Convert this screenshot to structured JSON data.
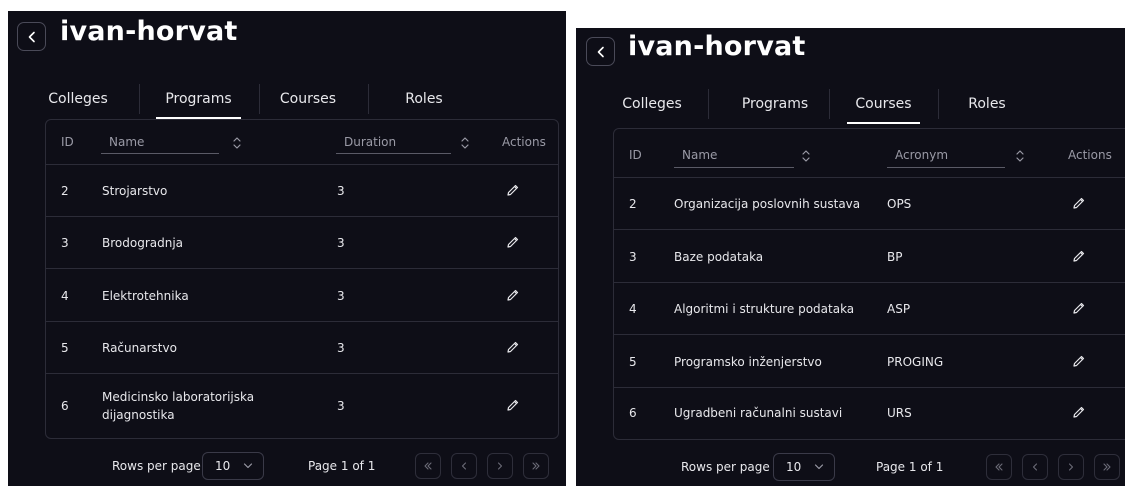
{
  "left": {
    "title": "ivan-horvat",
    "tabs": [
      "Colleges",
      "Programs",
      "Courses",
      "Roles"
    ],
    "active_tab": "Programs",
    "columns": {
      "id": "ID",
      "name": "Name",
      "third": "Duration",
      "actions": "Actions"
    },
    "rows": [
      {
        "id": "2",
        "name": "Strojarstvo",
        "value": "3"
      },
      {
        "id": "3",
        "name": "Brodogradnja",
        "value": "3"
      },
      {
        "id": "4",
        "name": "Elektrotehnika",
        "value": "3"
      },
      {
        "id": "5",
        "name": "Računarstvo",
        "value": "3"
      },
      {
        "id": "6",
        "name_line1": "Medicinsko laboratorijska",
        "name_line2": "dijagnostika",
        "value": "3"
      }
    ],
    "pagination": {
      "rows_per_page_label": "Rows per page",
      "rows_per_page": "10",
      "page_info": "Page 1 of 1"
    }
  },
  "right": {
    "title": "ivan-horvat",
    "tabs": [
      "Colleges",
      "Programs",
      "Courses",
      "Roles"
    ],
    "active_tab": "Courses",
    "columns": {
      "id": "ID",
      "name": "Name",
      "third": "Acronym",
      "actions": "Actions"
    },
    "rows": [
      {
        "id": "2",
        "name": "Organizacija poslovnih sustava",
        "value": "OPS"
      },
      {
        "id": "3",
        "name": "Baze podataka",
        "value": "BP"
      },
      {
        "id": "4",
        "name": "Algoritmi i strukture podataka",
        "value": "ASP"
      },
      {
        "id": "5",
        "name": "Programsko inženjerstvo",
        "value": "PROGING"
      },
      {
        "id": "6",
        "name": "Ugradbeni računalni sustavi",
        "value": "URS"
      }
    ],
    "pagination": {
      "rows_per_page_label": "Rows per page",
      "rows_per_page": "10",
      "page_info": "Page 1 of 1"
    }
  },
  "icons": {
    "back": "chevron-left-icon",
    "sort": "sort-updown-icon",
    "edit": "pencil-icon",
    "select": "chevron-down-icon",
    "first": "chevrons-left-icon",
    "prev": "chevron-left-icon",
    "next": "chevron-right-icon",
    "last": "chevrons-right-icon"
  },
  "colors": {
    "background": "#0e0e17",
    "border": "#2c2c38",
    "text": "#e8e8ec",
    "muted": "#9a9aa6"
  }
}
